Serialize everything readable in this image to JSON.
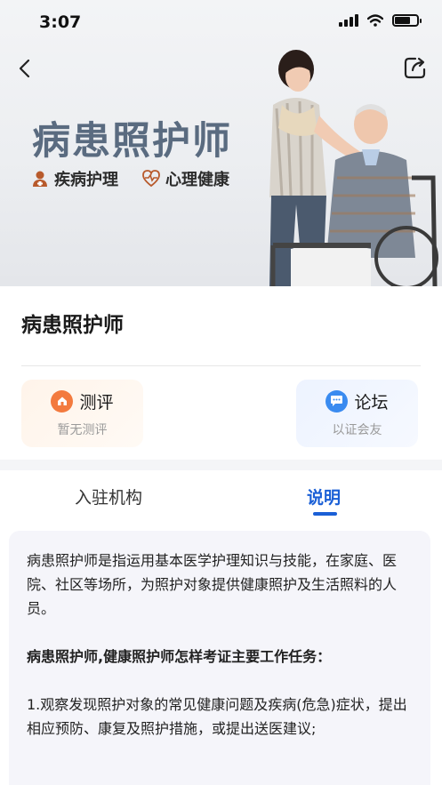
{
  "status_bar": {
    "time": "3:07"
  },
  "hero": {
    "title": "病患照护师",
    "tags": [
      {
        "icon": "user-icon",
        "label": "疾病护理"
      },
      {
        "icon": "heart-pulse-icon",
        "label": "心理健康"
      }
    ]
  },
  "page": {
    "title": "病患照护师"
  },
  "cards": [
    {
      "icon": "home-icon",
      "label": "测评",
      "sub": "暂无测评",
      "color": "#f37a3e"
    },
    {
      "icon": "chat-icon",
      "label": "论坛",
      "sub": "以证会友",
      "color": "#3a8bf0"
    }
  ],
  "tabs": [
    {
      "label": "入驻机构",
      "active": false
    },
    {
      "label": "说明",
      "active": true
    }
  ],
  "description": {
    "paragraphs": [
      "病患照护师是指运用基本医学护理知识与技能，在家庭、医院、社区等场所，为照护对象提供健康照护及生活照料的人员。",
      "病患照护师,健康照护师怎样考证主要工作任务：",
      "1.观察发现照护对象的常见健康问题及疾病(危急)症状，提出相应预防、康复及照护措施，或提出送医建议;"
    ]
  },
  "colors": {
    "accent": "#1a5fd6",
    "hero_title": "#5a6b80"
  }
}
